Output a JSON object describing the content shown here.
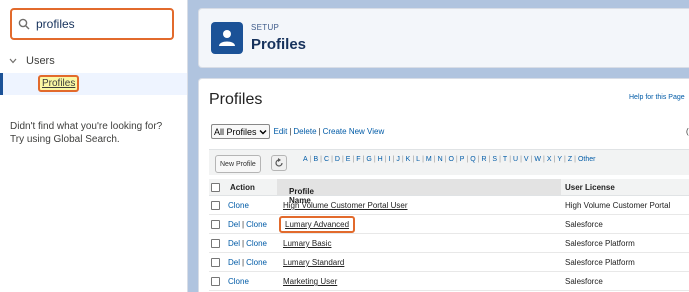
{
  "sidebar": {
    "search": {
      "value": "profiles",
      "icon": "search-icon"
    },
    "tree_parent": "Users",
    "tree_child": "Profiles",
    "no_result_line1": "Didn't find what you're looking for?",
    "no_result_line2": "Try using Global Search."
  },
  "header": {
    "eyebrow": "SETUP",
    "title": "Profiles",
    "icon": "user-icon"
  },
  "main": {
    "page_title": "Profiles",
    "help_link": "Help for this Page",
    "view": {
      "selected": "All Profiles",
      "edit": "Edit",
      "delete": "Delete",
      "create": "Create New View",
      "sep": "|"
    },
    "right_edge_char": "(",
    "new_button": "New Profile",
    "letters": [
      "A",
      "B",
      "C",
      "D",
      "E",
      "F",
      "G",
      "H",
      "I",
      "J",
      "K",
      "L",
      "M",
      "N",
      "O",
      "P",
      "Q",
      "R",
      "S",
      "T",
      "U",
      "V",
      "W",
      "X",
      "Y",
      "Z",
      "Other"
    ],
    "columns": {
      "action": "Action",
      "name": "Profile Name",
      "sort": "↑",
      "license": "User License"
    },
    "rows": [
      {
        "del": "",
        "clone": "Clone",
        "name": "High Volume Customer Portal User",
        "license": "High Volume Customer Portal"
      },
      {
        "del": "Del",
        "clone": "Clone",
        "name": "Lumary Advanced",
        "license": "Salesforce"
      },
      {
        "del": "Del",
        "clone": "Clone",
        "name": "Lumary Basic",
        "license": "Salesforce Platform"
      },
      {
        "del": "Del",
        "clone": "Clone",
        "name": "Lumary Standard",
        "license": "Salesforce Platform"
      },
      {
        "del": "",
        "clone": "Clone",
        "name": "Marketing User",
        "license": "Salesforce"
      }
    ]
  },
  "colors": {
    "highlight": "#e26a2c",
    "brand": "#1b5297",
    "link": "#015ba7"
  }
}
